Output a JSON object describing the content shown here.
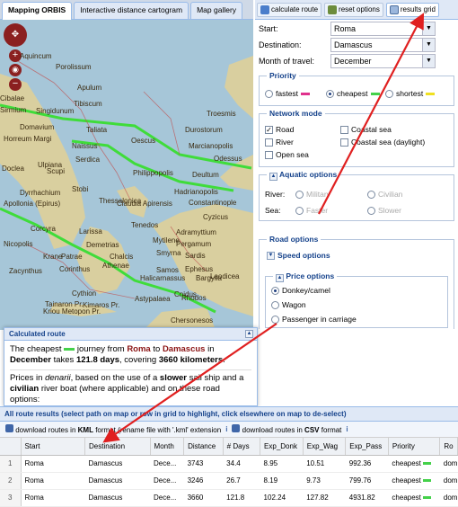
{
  "tabs": [
    {
      "label": "Mapping ORBIS"
    },
    {
      "label": "Interactive distance cartogram"
    },
    {
      "label": "Map gallery"
    }
  ],
  "toolbar": {
    "calculate": "calculate route",
    "reset": "reset options",
    "grid": "results grid"
  },
  "form": {
    "start_label": "Start:",
    "start_value": "Roma",
    "dest_label": "Destination:",
    "dest_value": "Damascus",
    "month_label": "Month of travel:",
    "month_value": "December"
  },
  "priority": {
    "legend": "Priority",
    "fastest": "fastest",
    "cheapest": "cheapest",
    "shortest": "shortest",
    "selected": "cheapest"
  },
  "network": {
    "legend": "Network mode",
    "road": "Road",
    "river": "River",
    "open_sea": "Open sea",
    "coastal": "Coastal sea",
    "coastal_day": "Coastal sea (daylight)",
    "road_checked": true
  },
  "aquatic": {
    "legend": "Aquatic options",
    "river": "River:",
    "sea": "Sea:",
    "military": "Military",
    "civilian": "Civilian",
    "faster": "Faster",
    "slower": "Slower"
  },
  "road_options": {
    "legend": "Road options",
    "speed": "Speed options",
    "price": "Price options",
    "donkey": "Donkey/camel",
    "wagon": "Wagon",
    "carriage": "Passenger in carriage",
    "selected": "Donkey/camel"
  },
  "calc": {
    "title": "Calculated route",
    "t1": "The cheapest",
    "t2": "journey from",
    "from": "Roma",
    "t3": "to",
    "to": "Damascus",
    "t4": "in",
    "month": "December",
    "t5": "takes",
    "days": "121.8 days",
    "t6": ", covering",
    "km": "3660 kilometers",
    "p2a": "Prices in",
    "p2b": "denarii",
    "p2c": ", based on the use of a",
    "p2d": "slower",
    "p2e": "sail ship and a",
    "p2f": "civilian",
    "p2g": "river boat (where applicable) and on these road",
    "p2h": "options:"
  },
  "results": {
    "title": "All route results (select path on map or row in grid to highlight, click elsewhere on map to de-select)",
    "kml_a": "download routes in",
    "kml_b": "KML",
    "kml_c": "format (rename file with '.kml' extension",
    "csv_a": "download routes in",
    "csv_b": "CSV",
    "csv_c": "format",
    "columns": [
      "",
      "Start",
      "Destination",
      "Month",
      "Distance",
      "# Days",
      "Exp_Donk",
      "Exp_Wag",
      "Exp_Pass",
      "Priority",
      "Ro"
    ],
    "rows": [
      [
        "1",
        "Roma",
        "Damascus",
        "Dece...",
        "3743",
        "34.4",
        "8.95",
        "10.51",
        "992.36",
        "cheapest",
        "dom"
      ],
      [
        "2",
        "Roma",
        "Damascus",
        "Dece...",
        "3246",
        "26.7",
        "8.19",
        "9.73",
        "799.76",
        "cheapest",
        "dom"
      ],
      [
        "3",
        "Roma",
        "Damascus",
        "Dece...",
        "3660",
        "121.8",
        "102.24",
        "127.82",
        "4931.82",
        "cheapest",
        "dom"
      ]
    ]
  },
  "places": [
    "Aquincum",
    "Porolissum",
    "Cibalae",
    "Apulum",
    "Tibiscum",
    "Sirmium",
    "Singidunum",
    "Domavium",
    "Taliata",
    "Horreum Margi",
    "Naissus",
    "Oescus",
    "Troesmis",
    "Durostorum",
    "Marcianopolis",
    "Ulpiana",
    "Serdica",
    "Odessus",
    "Doclea",
    "Scupi",
    "Philippopolis",
    "Deultum",
    "Stobi",
    "Hadrianopolis",
    "Dyrrhachium",
    "Apollonia (Epirus)",
    "Thessalonica",
    "Claudia Apirensis",
    "Constantinople",
    "Cyzicus",
    "Corcyra",
    "Larissa",
    "Tenedos",
    "Adramyttium",
    "Nicopolis",
    "Demetrias",
    "Mytilene",
    "Pergamum",
    "Krane",
    "Patrae",
    "Chalcis",
    "Smyrna",
    "Sardis",
    "Zacynthus",
    "Corinthus",
    "Athenae",
    "Ephesus",
    "Samos",
    "Laodicea",
    "Halicarnassus",
    "Bargylia",
    "Cnidus",
    "Cythion",
    "Astypalaea",
    "Rhodos",
    "Tainaron Pr.",
    "Kimaros Pr.",
    "Kriou Metopon Pr.",
    "Chersonesos"
  ],
  "colors": {
    "fastest": "#e0308c",
    "cheapest": "#44d14a",
    "shortest": "#f0e020",
    "accent": "#15428b",
    "route": "#3fdc3a",
    "arrow": "#e02020"
  },
  "icons": [
    "pan-icon",
    "zoom-in-icon",
    "zoom-out-icon",
    "globe-icon",
    "calculate-icon",
    "reset-icon",
    "grid-icon",
    "save-icon",
    "info-icon",
    "collapse-icon"
  ]
}
